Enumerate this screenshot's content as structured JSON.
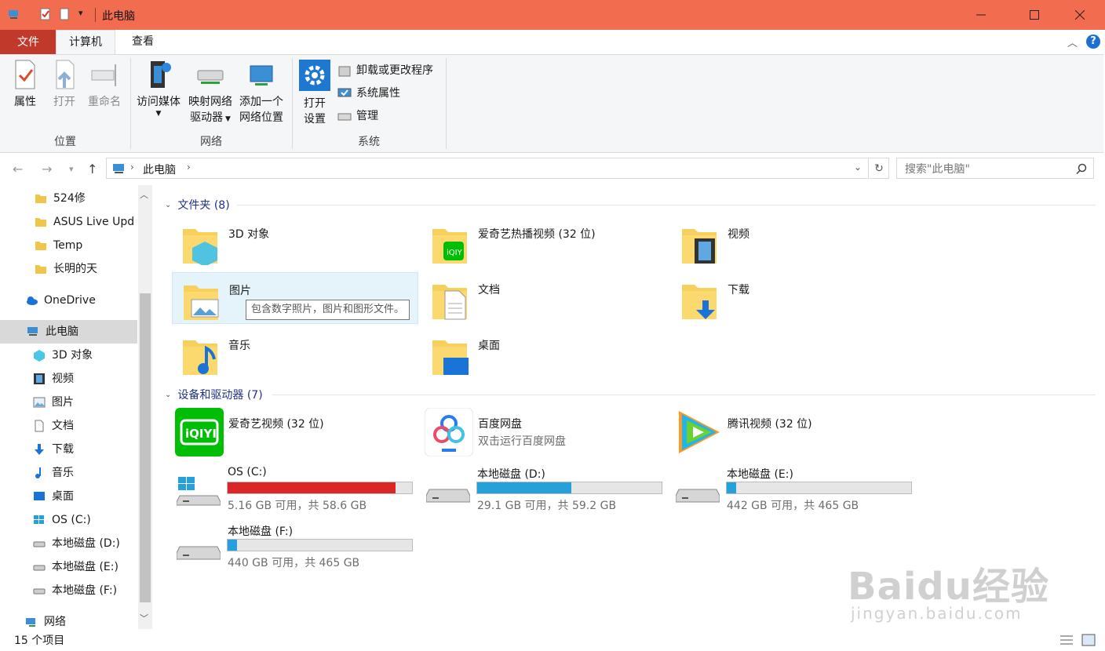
{
  "window": {
    "title": "此电脑"
  },
  "ribbon_tabs": {
    "file": "文件",
    "computer": "计算机",
    "view": "查看"
  },
  "ribbon": {
    "location": {
      "label": "位置",
      "properties": "属性",
      "open": "打开",
      "rename": "重命名"
    },
    "network": {
      "label": "网络",
      "media_line1": "访问媒体",
      "map_line1": "映射网络",
      "map_line2": "驱动器",
      "add_line1": "添加一个",
      "add_line2": "网络位置"
    },
    "system": {
      "label": "系统",
      "settings_line1": "打开",
      "settings_line2": "设置",
      "uninstall": "卸载或更改程序",
      "sysprops": "系统属性",
      "manage": "管理"
    }
  },
  "address": {
    "path": "此电脑",
    "search_placeholder": "搜索\"此电脑\""
  },
  "nav": {
    "items": [
      "524修",
      "ASUS Live Upd",
      "Temp",
      "长明的天",
      "OneDrive",
      "此电脑",
      "3D 对象",
      "视频",
      "图片",
      "文档",
      "下载",
      "音乐",
      "桌面",
      "OS (C:)",
      "本地磁盘 (D:)",
      "本地磁盘 (E:)",
      "本地磁盘 (F:)",
      "网络"
    ]
  },
  "folders": {
    "header": "文件夹 (8)",
    "items": [
      "3D 对象",
      "爱奇艺热播视频 (32 位)",
      "视频",
      "图片",
      "文档",
      "下载",
      "音乐",
      "桌面"
    ]
  },
  "tooltip": "包含数字照片，图片和图形文件。",
  "devices": {
    "header": "设备和驱动器 (7)",
    "apps": [
      {
        "name": "爱奇艺视频 (32 位)",
        "sub": ""
      },
      {
        "name": "百度网盘",
        "sub": "双击运行百度网盘"
      },
      {
        "name": "腾讯视频 (32 位)",
        "sub": ""
      }
    ],
    "drives": [
      {
        "name": "OS (C:)",
        "info": "5.16 GB 可用，共 58.6 GB",
        "used_pct": 91
      },
      {
        "name": "本地磁盘 (D:)",
        "info": "29.1 GB 可用，共 59.2 GB",
        "used_pct": 51
      },
      {
        "name": "本地磁盘 (E:)",
        "info": "442 GB 可用，共 465 GB",
        "used_pct": 5
      },
      {
        "name": "本地磁盘 (F:)",
        "info": "440 GB 可用，共 465 GB",
        "used_pct": 5
      }
    ]
  },
  "status": {
    "count": "15 个项目"
  },
  "watermark": {
    "brand": "Baidu经验",
    "url": "jingyan.baidu.com"
  },
  "colors": {
    "titlebar": "#f26c4f",
    "file_tab": "#c0392b",
    "drive_full": "#da2626",
    "drive_normal": "#26a0da"
  }
}
